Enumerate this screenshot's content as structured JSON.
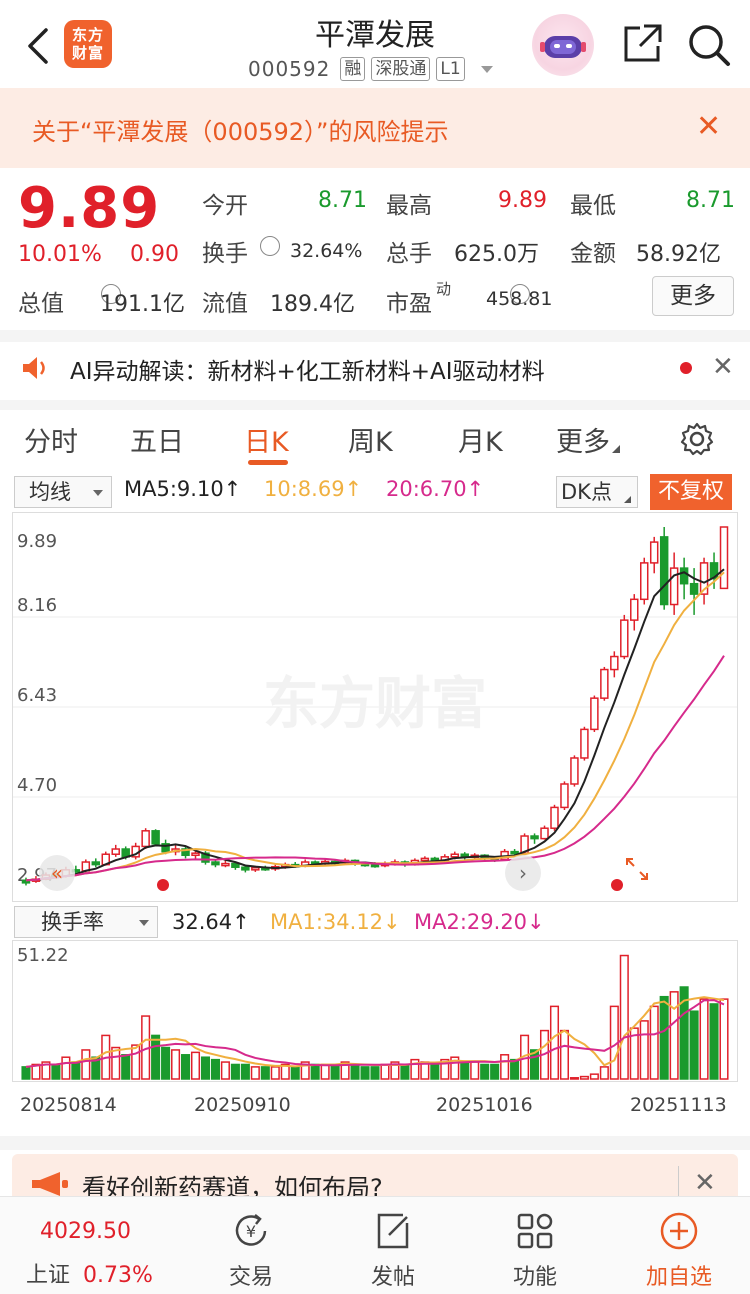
{
  "header": {
    "logo_line1": "东方",
    "logo_line2": "财富",
    "title": "平潭发展",
    "code": "000592",
    "tags": [
      "融",
      "深股通",
      "L1"
    ]
  },
  "risk_banner": {
    "text": "关于“平潭发展（000592）”的风险提示"
  },
  "quote": {
    "price": "9.89",
    "change_pct": "10.01%",
    "change_amt": "0.90",
    "open_label": "今开",
    "open": "8.71",
    "high_label": "最高",
    "high": "9.89",
    "low_label": "最低",
    "low": "8.71",
    "turnover_label": "换手",
    "turnover": "32.64%",
    "volume_label": "总手",
    "volume": "625.0万",
    "amount_label": "金额",
    "amount": "58.92亿",
    "mktcap_label": "总值",
    "mktcap": "191.1亿",
    "float_label": "流值",
    "float": "189.4亿",
    "pe_label": "市盈",
    "pe_sup": "动",
    "pe": "458.81",
    "more_button": "更多"
  },
  "ai_row": {
    "text": "AI异动解读：新材料+化工新材料+AI驱动材料"
  },
  "tabs": [
    "分时",
    "五日",
    "日K",
    "周K",
    "月K",
    "更多"
  ],
  "active_tab": "日K",
  "toolbar": {
    "indicator": "均线",
    "ma5": "MA5:9.10↑",
    "ma10": "10:8.69↑",
    "ma20": "20:6.70↑",
    "dk": "DK点",
    "adjust": "不复权"
  },
  "vol_toolbar": {
    "indicator": "换手率",
    "value": "32.64↑",
    "ma1": "MA1:34.12↓",
    "ma2": "MA2:29.20↓"
  },
  "colors": {
    "up": "#e0202a",
    "down": "#1a9a2d",
    "ma5": "#222222",
    "ma10": "#f0b040",
    "ma20": "#d62a8c",
    "accent": "#e85a24"
  },
  "chart_data": {
    "type": "candlestick",
    "y_ticks": [
      "9.89",
      "8.16",
      "6.43",
      "4.70",
      "2.97"
    ],
    "ylim": [
      2.97,
      9.89
    ],
    "volume_ylim": [
      0,
      51.22
    ],
    "volume_top_label": "51.22",
    "x_labels": [
      "20250814",
      "20250910",
      "20251016",
      "20251113"
    ],
    "watermark": "东方财富",
    "candles": [
      [
        3.05,
        3.1,
        3.0,
        3.15,
        0,
        5
      ],
      [
        3.1,
        3.12,
        3.05,
        3.18,
        1,
        6
      ],
      [
        3.12,
        3.2,
        3.1,
        3.25,
        1,
        7
      ],
      [
        3.2,
        3.18,
        3.15,
        3.26,
        0,
        6
      ],
      [
        3.18,
        3.3,
        3.15,
        3.36,
        1,
        9
      ],
      [
        3.3,
        3.28,
        3.22,
        3.38,
        0,
        7
      ],
      [
        3.28,
        3.45,
        3.25,
        3.5,
        1,
        12
      ],
      [
        3.45,
        3.4,
        3.35,
        3.52,
        0,
        9
      ],
      [
        3.4,
        3.6,
        3.38,
        3.65,
        1,
        18
      ],
      [
        3.6,
        3.7,
        3.55,
        3.78,
        1,
        13
      ],
      [
        3.7,
        3.55,
        3.5,
        3.75,
        0,
        10
      ],
      [
        3.55,
        3.75,
        3.5,
        3.82,
        1,
        14
      ],
      [
        3.75,
        4.05,
        3.7,
        4.1,
        1,
        26
      ],
      [
        4.05,
        3.8,
        3.75,
        4.08,
        0,
        18
      ],
      [
        3.8,
        3.65,
        3.6,
        3.88,
        0,
        13
      ],
      [
        3.65,
        3.7,
        3.58,
        3.78,
        1,
        12
      ],
      [
        3.7,
        3.58,
        3.52,
        3.75,
        0,
        10
      ],
      [
        3.58,
        3.62,
        3.5,
        3.7,
        1,
        11
      ],
      [
        3.62,
        3.45,
        3.4,
        3.66,
        0,
        9
      ],
      [
        3.45,
        3.4,
        3.35,
        3.5,
        0,
        8
      ],
      [
        3.4,
        3.42,
        3.35,
        3.48,
        1,
        7
      ],
      [
        3.42,
        3.35,
        3.3,
        3.45,
        0,
        6
      ],
      [
        3.35,
        3.3,
        3.25,
        3.4,
        0,
        6
      ],
      [
        3.3,
        3.34,
        3.26,
        3.38,
        1,
        5
      ],
      [
        3.34,
        3.32,
        3.28,
        3.38,
        0,
        5
      ],
      [
        3.32,
        3.36,
        3.28,
        3.4,
        1,
        5
      ],
      [
        3.36,
        3.4,
        3.32,
        3.44,
        1,
        6
      ],
      [
        3.4,
        3.38,
        3.34,
        3.45,
        0,
        5
      ],
      [
        3.38,
        3.45,
        3.35,
        3.5,
        1,
        7
      ],
      [
        3.45,
        3.42,
        3.38,
        3.48,
        0,
        6
      ],
      [
        3.42,
        3.46,
        3.38,
        3.5,
        1,
        6
      ],
      [
        3.46,
        3.44,
        3.4,
        3.5,
        0,
        6
      ],
      [
        3.44,
        3.48,
        3.4,
        3.52,
        1,
        7
      ],
      [
        3.48,
        3.42,
        3.38,
        3.5,
        0,
        6
      ],
      [
        3.42,
        3.4,
        3.36,
        3.46,
        0,
        5
      ],
      [
        3.4,
        3.38,
        3.34,
        3.45,
        0,
        5
      ],
      [
        3.38,
        3.42,
        3.35,
        3.46,
        1,
        6
      ],
      [
        3.42,
        3.45,
        3.38,
        3.5,
        1,
        7
      ],
      [
        3.45,
        3.4,
        3.36,
        3.48,
        0,
        6
      ],
      [
        3.4,
        3.48,
        3.38,
        3.52,
        1,
        8
      ],
      [
        3.48,
        3.52,
        3.44,
        3.56,
        1,
        7
      ],
      [
        3.52,
        3.48,
        3.44,
        3.55,
        0,
        6
      ],
      [
        3.48,
        3.55,
        3.45,
        3.6,
        1,
        8
      ],
      [
        3.55,
        3.6,
        3.5,
        3.65,
        1,
        9
      ],
      [
        3.6,
        3.55,
        3.5,
        3.64,
        0,
        7
      ],
      [
        3.55,
        3.58,
        3.5,
        3.62,
        1,
        7
      ],
      [
        3.58,
        3.52,
        3.48,
        3.6,
        0,
        6
      ],
      [
        3.52,
        3.5,
        3.45,
        3.56,
        0,
        6
      ],
      [
        3.5,
        3.65,
        3.48,
        3.7,
        1,
        10
      ],
      [
        3.65,
        3.62,
        3.55,
        3.7,
        0,
        8
      ],
      [
        3.62,
        3.95,
        3.6,
        4.0,
        1,
        18
      ],
      [
        3.95,
        3.9,
        3.8,
        4.0,
        0,
        12
      ],
      [
        3.9,
        4.1,
        3.88,
        4.15,
        1,
        20
      ],
      [
        4.1,
        4.5,
        4.05,
        4.55,
        1,
        30
      ],
      [
        4.5,
        4.95,
        4.45,
        5.0,
        1,
        20
      ],
      [
        4.95,
        5.45,
        4.9,
        5.5,
        1,
        0.5
      ],
      [
        5.45,
        6.0,
        5.4,
        6.05,
        1,
        1
      ],
      [
        6.0,
        6.6,
        5.95,
        6.65,
        1,
        2
      ],
      [
        6.6,
        7.15,
        6.55,
        7.2,
        1,
        5
      ],
      [
        7.15,
        7.4,
        7.0,
        7.5,
        1,
        30
      ],
      [
        7.4,
        8.1,
        7.35,
        8.2,
        1,
        51
      ],
      [
        8.1,
        8.5,
        7.9,
        8.6,
        1,
        21
      ],
      [
        8.5,
        9.2,
        8.4,
        9.3,
        1,
        24
      ],
      [
        9.2,
        9.6,
        9.0,
        9.7,
        1,
        30
      ],
      [
        9.7,
        8.4,
        8.3,
        9.89,
        0,
        34
      ],
      [
        8.4,
        9.1,
        8.2,
        9.4,
        1,
        36
      ],
      [
        9.1,
        8.8,
        8.5,
        9.3,
        0,
        38
      ],
      [
        8.8,
        8.6,
        8.2,
        9.1,
        0,
        28
      ],
      [
        8.6,
        9.2,
        8.4,
        9.3,
        1,
        33
      ],
      [
        9.2,
        8.9,
        8.7,
        9.4,
        0,
        31
      ],
      [
        8.71,
        9.89,
        8.71,
        9.89,
        1,
        33
      ]
    ]
  }
}
